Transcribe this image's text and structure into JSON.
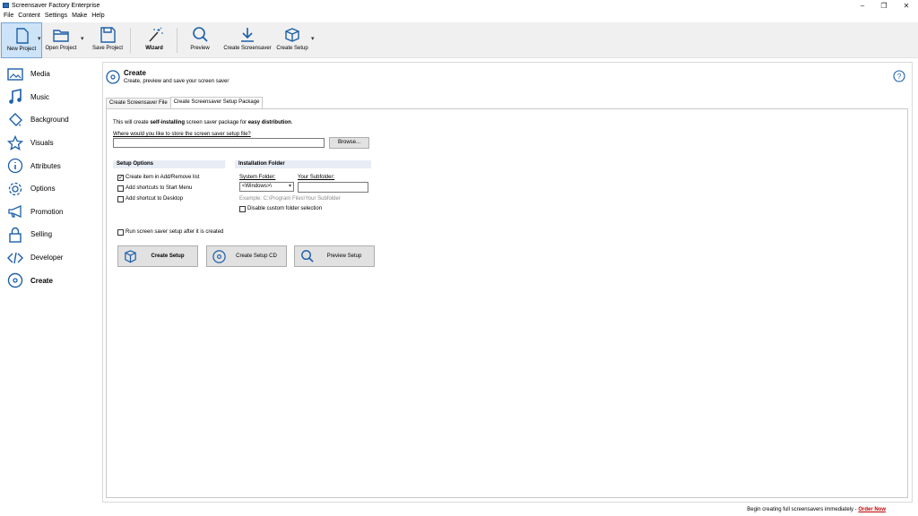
{
  "window": {
    "title": "Screensaver Factory Enterprise",
    "minimize": "–",
    "restore": "❐",
    "close": "✕"
  },
  "menu": [
    "File",
    "Content",
    "Settings",
    "Make",
    "Help"
  ],
  "toolbar": {
    "new_project": "New Project",
    "open_project": "Open Project",
    "save_project": "Save Project",
    "wizard": "Wizard",
    "preview": "Preview",
    "create_screensaver": "Create Screensaver",
    "create_setup": "Create Setup",
    "dropdown_glyph": "▾"
  },
  "sidebar": {
    "items": [
      {
        "label": "Media",
        "icon": "image-icon"
      },
      {
        "label": "Music",
        "icon": "music-note-icon"
      },
      {
        "label": "Background",
        "icon": "paint-bucket-icon"
      },
      {
        "label": "Visuals",
        "icon": "star-icon"
      },
      {
        "label": "Attributes",
        "icon": "info-icon"
      },
      {
        "label": "Options",
        "icon": "gear-icon"
      },
      {
        "label": "Promotion",
        "icon": "megaphone-icon"
      },
      {
        "label": "Selling",
        "icon": "lock-icon"
      },
      {
        "label": "Developer",
        "icon": "code-icon"
      },
      {
        "label": "Create",
        "icon": "disc-icon",
        "active": true
      }
    ]
  },
  "header": {
    "title": "Create",
    "subtitle": "Create, preview and save your screen saver",
    "help": "?"
  },
  "tabs": [
    "Create Screensaver File",
    "Create Screensaver Setup Package"
  ],
  "setup": {
    "intro_pre": "This will create ",
    "intro_bold1": "self-installing",
    "intro_mid": " screen saver package for ",
    "intro_bold2": "easy distribution",
    "intro_post": ".",
    "path_label": "Where would you like to store the screen saver setup file?",
    "path_value": "",
    "browse": "Browse...",
    "options_header": "Setup Options",
    "opt_addremove": "Create item in Add/Remove list",
    "opt_startmenu": "Add shortcuts to Start Menu",
    "opt_desktop": "Add shortcut to Desktop",
    "folder_header": "Installation Folder",
    "system_folder_label": "System Folder:",
    "system_folder_value": "<Windows>\\",
    "subfolder_label": "Your Subfolder:",
    "subfolder_value": "",
    "example": "Example: C:\\Program Files\\Your Subfolder",
    "disable_custom": "Disable custom folder selection",
    "run_after": "Run screen saver setup after it is created",
    "btn_create_setup": "Create Setup",
    "btn_create_cd": "Create Setup CD",
    "btn_preview_setup": "Preview Setup",
    "checked": {
      "addremove": true,
      "startmenu": false,
      "desktop": false,
      "disable_custom": false,
      "run_after": false
    }
  },
  "footer": {
    "text": "Begin creating full screensavers immediately - ",
    "link": "Order Now"
  },
  "colors": {
    "accent": "#1c5fa8",
    "link_red": "#c00000"
  }
}
